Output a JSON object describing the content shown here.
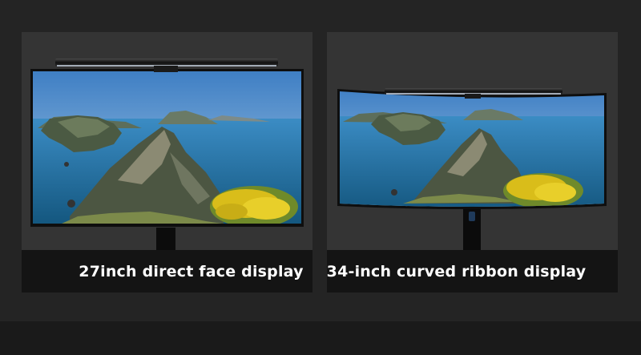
{
  "panels": [
    {
      "caption": "27inch direct face display"
    },
    {
      "caption": "34-inch curved ribbon display"
    }
  ],
  "colors": {
    "background": "#242424",
    "panel": "#343434",
    "caption_bar": "#141414",
    "caption_text": "#ffffff",
    "sky": "#4a86c6",
    "sea": "#1f6fa8",
    "flowers": "#e3c41c"
  },
  "icons": [
    "monitor-light-bar",
    "monitor-stand"
  ]
}
